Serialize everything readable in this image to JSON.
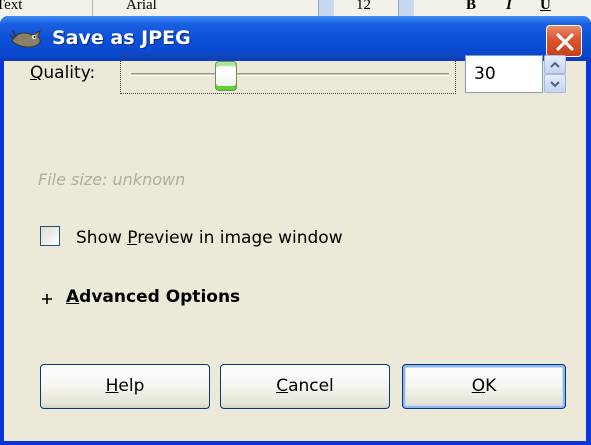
{
  "background_toolbar": {
    "font_label": "Text",
    "font_name": "Arial",
    "font_size": "12",
    "bold_label": "B",
    "italic_label": "I",
    "underline_label": "U"
  },
  "dialog": {
    "title": "Save as JPEG",
    "title_icon": "gimp-wilber-icon",
    "close_icon": "close-icon"
  },
  "quality": {
    "label_pre": "",
    "label_mnemonic": "Q",
    "label_post": "uality:",
    "value": "30",
    "slider_fraction": 0.3
  },
  "file_size": "File size: unknown",
  "preview": {
    "label_pre": "Show ",
    "label_mnemonic": "P",
    "label_post": "review in image window",
    "checked": false
  },
  "advanced": {
    "expander_icon": "plus-expander-icon",
    "label_pre": "",
    "label_mnemonic": "A",
    "label_post": "dvanced Options",
    "expanded": false
  },
  "buttons": {
    "help": {
      "pre": "",
      "mnemonic": "H",
      "post": "elp"
    },
    "cancel": {
      "pre": "",
      "mnemonic": "C",
      "post": "ancel"
    },
    "ok": {
      "pre": "",
      "mnemonic": "O",
      "post": "K"
    }
  },
  "colors": {
    "titlebar": "#0a4fd6",
    "client": "#ece9d8",
    "close": "#d8552e",
    "slider_thumb_accent": "#5fcf3a"
  }
}
